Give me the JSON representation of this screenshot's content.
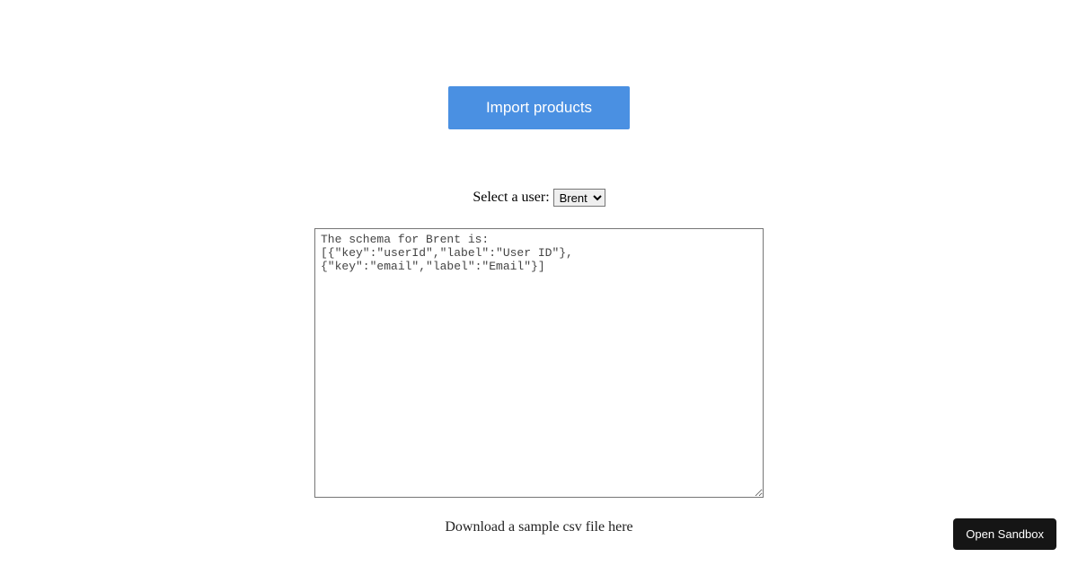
{
  "buttons": {
    "import_label": "Import products",
    "open_sandbox_label": "Open Sandbox"
  },
  "user_select": {
    "label": "Select a user: ",
    "selected": "Brent",
    "options": [
      "Brent"
    ]
  },
  "schema_text": "The schema for Brent is:\n[{\"key\":\"userId\",\"label\":\"User ID\"},\n{\"key\":\"email\",\"label\":\"Email\"}]",
  "download_text": "Download a sample csv file here"
}
